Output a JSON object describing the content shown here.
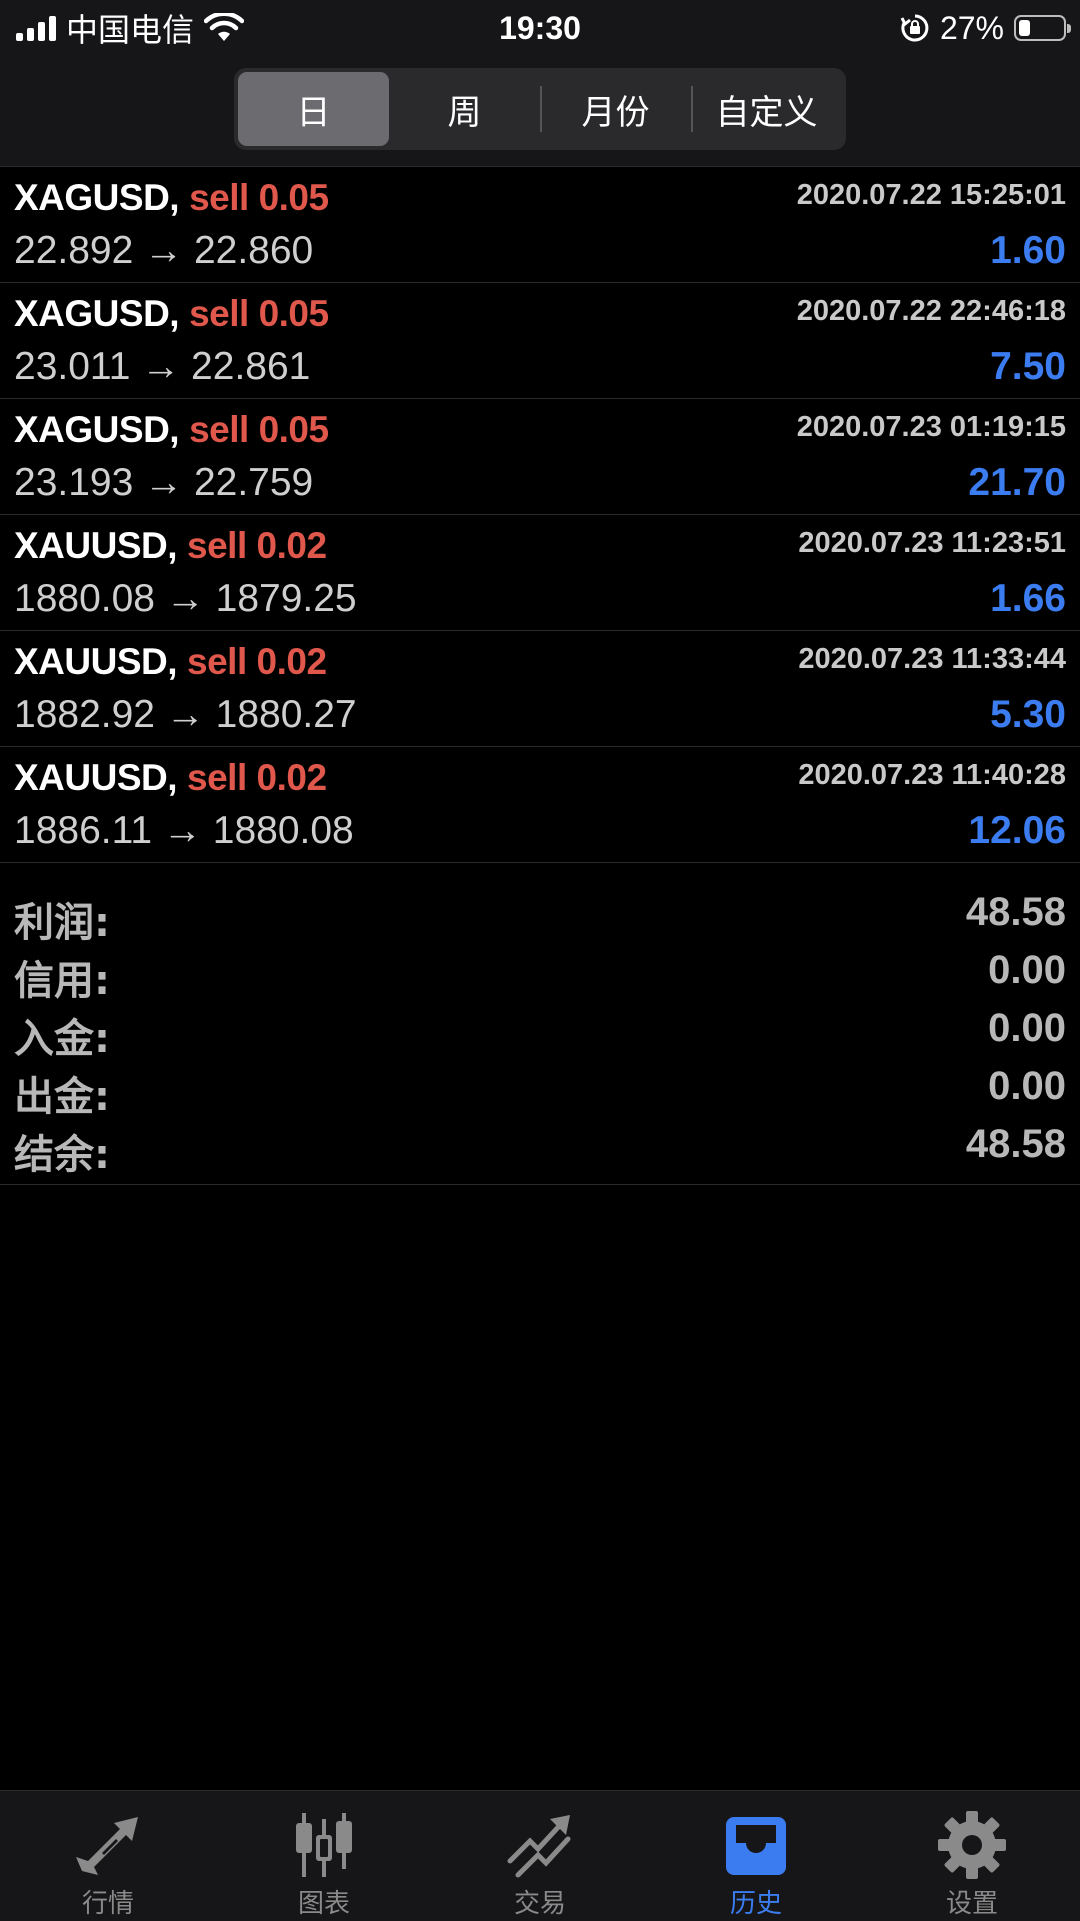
{
  "status_bar": {
    "carrier": "中国电信",
    "time": "19:30",
    "battery_percent": "27%",
    "battery_level": 0.27
  },
  "segments": [
    {
      "label": "日",
      "active": true
    },
    {
      "label": "周",
      "active": false
    },
    {
      "label": "月份",
      "active": false
    },
    {
      "label": "自定义",
      "active": false
    }
  ],
  "trades": [
    {
      "symbol": "XAGUSD,",
      "side": "sell 0.05",
      "time": "2020.07.22 15:25:01",
      "prices": "22.892 → 22.860",
      "profit": "1.60"
    },
    {
      "symbol": "XAGUSD,",
      "side": "sell 0.05",
      "time": "2020.07.22 22:46:18",
      "prices": "23.011 → 22.861",
      "profit": "7.50"
    },
    {
      "symbol": "XAGUSD,",
      "side": "sell 0.05",
      "time": "2020.07.23 01:19:15",
      "prices": "23.193 → 22.759",
      "profit": "21.70"
    },
    {
      "symbol": "XAUUSD,",
      "side": "sell 0.02",
      "time": "2020.07.23 11:23:51",
      "prices": "1880.08 → 1879.25",
      "profit": "1.66"
    },
    {
      "symbol": "XAUUSD,",
      "side": "sell 0.02",
      "time": "2020.07.23 11:33:44",
      "prices": "1882.92 → 1880.27",
      "profit": "5.30"
    },
    {
      "symbol": "XAUUSD,",
      "side": "sell 0.02",
      "time": "2020.07.23 11:40:28",
      "prices": "1886.11 → 1880.08",
      "profit": "12.06"
    }
  ],
  "summary": [
    {
      "label": "利润:",
      "value": "48.58"
    },
    {
      "label": "信用:",
      "value": "0.00"
    },
    {
      "label": "入金:",
      "value": "0.00"
    },
    {
      "label": "出金:",
      "value": "0.00"
    },
    {
      "label": "结余:",
      "value": "48.58"
    }
  ],
  "tabs": [
    {
      "label": "行情",
      "icon": "quotes-arrows-icon",
      "active": false
    },
    {
      "label": "图表",
      "icon": "candlestick-chart-icon",
      "active": false
    },
    {
      "label": "交易",
      "icon": "trade-trend-icon",
      "active": false
    },
    {
      "label": "历史",
      "icon": "history-inbox-icon",
      "active": true
    },
    {
      "label": "设置",
      "icon": "gear-icon",
      "active": false
    }
  ],
  "colors": {
    "sell": "#e0574b",
    "profit": "#3b7df0",
    "active_tab": "#3b7df0",
    "inactive_tab": "#8a8a8a",
    "background": "#000000"
  }
}
